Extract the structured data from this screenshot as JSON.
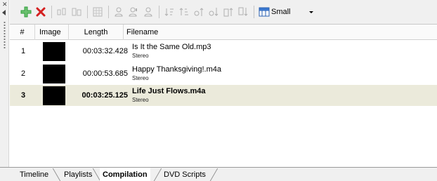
{
  "toolbar": {
    "buttons": [
      {
        "icon": "add-icon"
      },
      {
        "icon": "remove-icon"
      },
      {
        "icon": "split-icon"
      },
      {
        "icon": "merge-icon"
      },
      {
        "icon": "grid-icon"
      },
      {
        "icon": "user-icon"
      },
      {
        "icon": "user-edit-icon"
      },
      {
        "icon": "user-add-icon"
      },
      {
        "icon": "sort-icon"
      },
      {
        "icon": "sort-alt-icon"
      },
      {
        "icon": "move-up-icon"
      },
      {
        "icon": "move-down-icon"
      },
      {
        "icon": "move-top-icon"
      },
      {
        "icon": "move-bottom-icon"
      }
    ],
    "size_select": {
      "value": "Small",
      "icon": "view-size-icon"
    }
  },
  "table": {
    "columns": [
      "#",
      "Image",
      "Length",
      "Filename"
    ],
    "rows": [
      {
        "num": "1",
        "length": "00:03:32.428",
        "filename": "Is It the Same Old.mp3",
        "subtitle": "Stereo",
        "selected": false
      },
      {
        "num": "2",
        "length": "00:00:53.685",
        "filename": "Happy Thanksgiving!.m4a",
        "subtitle": "Stereo",
        "selected": false
      },
      {
        "num": "3",
        "length": "00:03:25.125",
        "filename": "Life Just Flows.m4a",
        "subtitle": "Stereo",
        "selected": true
      }
    ]
  },
  "tabs": [
    "Timeline",
    "Playlists",
    "Compilation",
    "DVD Scripts"
  ],
  "active_tab": "Compilation",
  "colors": {
    "selected_row": "#ebeadb",
    "toolbar_bg": "#f0f0f0",
    "add_green": "#2e9e3a",
    "remove_red": "#d42020"
  }
}
